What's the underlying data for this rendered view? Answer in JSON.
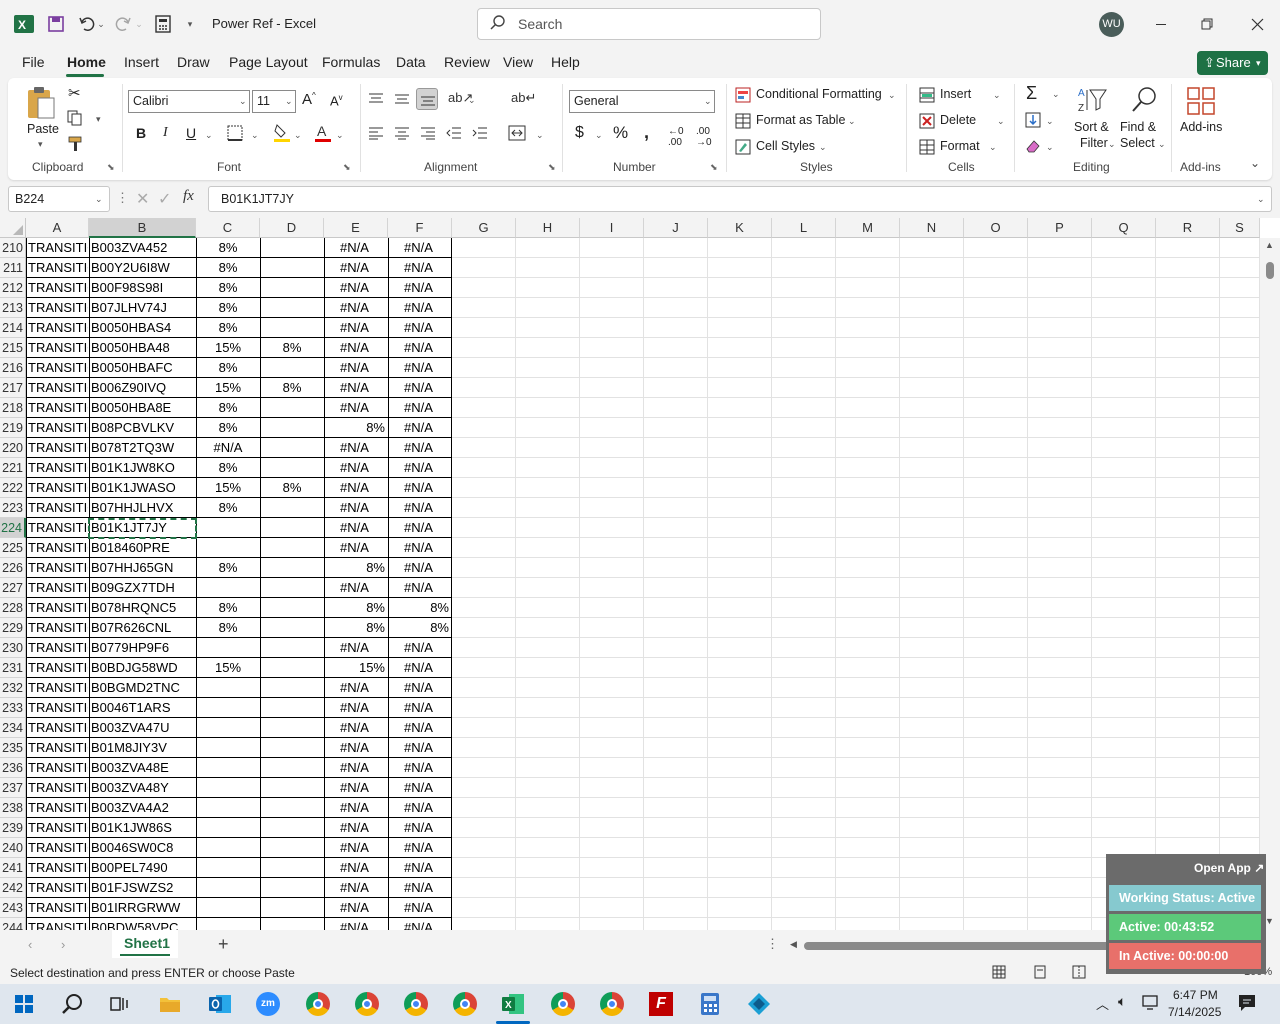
{
  "titlebar": {
    "app_title": "Power Ref  -  Excel",
    "search_placeholder": "Search",
    "user_initials": "WU"
  },
  "menu": {
    "items": [
      "File",
      "Home",
      "Insert",
      "Draw",
      "Page Layout",
      "Formulas",
      "Data",
      "Review",
      "View",
      "Help"
    ],
    "active": "Home",
    "share_label": "Share"
  },
  "ribbon": {
    "clipboard": {
      "paste": "Paste",
      "label": "Clipboard"
    },
    "font": {
      "name": "Calibri",
      "size": "11",
      "label": "Font"
    },
    "alignment": {
      "label": "Alignment"
    },
    "number": {
      "format": "General",
      "label": "Number"
    },
    "styles": {
      "conditional": "Conditional Formatting",
      "table": "Format as Table",
      "cell": "Cell Styles",
      "label": "Styles"
    },
    "cells": {
      "insert": "Insert",
      "delete": "Delete",
      "format": "Format",
      "label": "Cells"
    },
    "editing": {
      "sort": "Sort &",
      "filter": "Filter",
      "find": "Find &",
      "select": "Select",
      "label": "Editing"
    },
    "addins": {
      "name": "Add-ins",
      "label": "Add-ins"
    }
  },
  "formula": {
    "name_box": "B224",
    "value": "B01K1JT7JY"
  },
  "columns": [
    "A",
    "B",
    "C",
    "D",
    "E",
    "F",
    "G",
    "H",
    "I",
    "J",
    "K",
    "L",
    "M",
    "N",
    "O",
    "P",
    "Q",
    "R",
    "S"
  ],
  "rows": [
    {
      "n": "210",
      "a": "TRANSITIO",
      "b": "B003ZVA452",
      "c": "8%",
      "d": "",
      "e": "#N/A",
      "f": "#N/A"
    },
    {
      "n": "211",
      "a": "TRANSITIO",
      "b": "B00Y2U6I8W",
      "c": "8%",
      "d": "",
      "e": "#N/A",
      "f": "#N/A"
    },
    {
      "n": "212",
      "a": "TRANSITIO",
      "b": "B00F98S98I",
      "c": "8%",
      "d": "",
      "e": "#N/A",
      "f": "#N/A"
    },
    {
      "n": "213",
      "a": "TRANSITIO",
      "b": "B07JLHV74J",
      "c": "8%",
      "d": "",
      "e": "#N/A",
      "f": "#N/A"
    },
    {
      "n": "214",
      "a": "TRANSITIO",
      "b": "B0050HBAS4",
      "c": "8%",
      "d": "",
      "e": "#N/A",
      "f": "#N/A"
    },
    {
      "n": "215",
      "a": "TRANSITIO",
      "b": "B0050HBA48",
      "c": "15%",
      "d": "8%",
      "e": "#N/A",
      "f": "#N/A"
    },
    {
      "n": "216",
      "a": "TRANSITIO",
      "b": "B0050HBAFC",
      "c": "8%",
      "d": "",
      "e": "#N/A",
      "f": "#N/A"
    },
    {
      "n": "217",
      "a": "TRANSITIO",
      "b": "B006Z90IVQ",
      "c": "15%",
      "d": "8%",
      "e": "#N/A",
      "f": "#N/A"
    },
    {
      "n": "218",
      "a": "TRANSITIO",
      "b": "B0050HBA8E",
      "c": "8%",
      "d": "",
      "e": "#N/A",
      "f": "#N/A"
    },
    {
      "n": "219",
      "a": "TRANSITIO",
      "b": "B08PCBVLKV",
      "c": "8%",
      "d": "",
      "e": "8%",
      "f": "#N/A"
    },
    {
      "n": "220",
      "a": "TRANSITIO",
      "b": "B078T2TQ3W",
      "c": "#N/A",
      "d": "",
      "e": "#N/A",
      "f": "#N/A"
    },
    {
      "n": "221",
      "a": "TRANSITIO",
      "b": "B01K1JW8KO",
      "c": "8%",
      "d": "",
      "e": "#N/A",
      "f": "#N/A"
    },
    {
      "n": "222",
      "a": "TRANSITIO",
      "b": "B01K1JWASO",
      "c": "15%",
      "d": "8%",
      "e": "#N/A",
      "f": "#N/A"
    },
    {
      "n": "223",
      "a": "TRANSITIO",
      "b": "B07HHJLHVX",
      "c": "8%",
      "d": "",
      "e": "#N/A",
      "f": "#N/A"
    },
    {
      "n": "224",
      "a": "TRANSITIO",
      "b": "B01K1JT7JY",
      "c": "",
      "d": "",
      "e": "#N/A",
      "f": "#N/A"
    },
    {
      "n": "225",
      "a": "TRANSITIO",
      "b": "B018460PRE",
      "c": "",
      "d": "",
      "e": "#N/A",
      "f": "#N/A"
    },
    {
      "n": "226",
      "a": "TRANSITIO",
      "b": "B07HHJ65GN",
      "c": "8%",
      "d": "",
      "e": "8%",
      "f": "#N/A"
    },
    {
      "n": "227",
      "a": "TRANSITIO",
      "b": "B09GZX7TDH",
      "c": "",
      "d": "",
      "e": "#N/A",
      "f": "#N/A"
    },
    {
      "n": "228",
      "a": "TRANSITIO",
      "b": "B078HRQNC5",
      "c": "8%",
      "d": "",
      "e": "8%",
      "f": "8%"
    },
    {
      "n": "229",
      "a": "TRANSITIO",
      "b": "B07R626CNL",
      "c": "8%",
      "d": "",
      "e": "8%",
      "f": "8%"
    },
    {
      "n": "230",
      "a": "TRANSITIO",
      "b": "B0779HP9F6",
      "c": "",
      "d": "",
      "e": "#N/A",
      "f": "#N/A"
    },
    {
      "n": "231",
      "a": "TRANSITIO",
      "b": "B0BDJG58WD",
      "c": "15%",
      "d": "",
      "e": "15%",
      "f": "#N/A"
    },
    {
      "n": "232",
      "a": "TRANSITIO",
      "b": "B0BGMD2TNC",
      "c": "",
      "d": "",
      "e": "#N/A",
      "f": "#N/A"
    },
    {
      "n": "233",
      "a": "TRANSITIO",
      "b": "B0046T1ARS",
      "c": "",
      "d": "",
      "e": "#N/A",
      "f": "#N/A"
    },
    {
      "n": "234",
      "a": "TRANSITIO",
      "b": "B003ZVA47U",
      "c": "",
      "d": "",
      "e": "#N/A",
      "f": "#N/A"
    },
    {
      "n": "235",
      "a": "TRANSITIO",
      "b": "B01M8JIY3V",
      "c": "",
      "d": "",
      "e": "#N/A",
      "f": "#N/A"
    },
    {
      "n": "236",
      "a": "TRANSITIO",
      "b": "B003ZVA48E",
      "c": "",
      "d": "",
      "e": "#N/A",
      "f": "#N/A"
    },
    {
      "n": "237",
      "a": "TRANSITIO",
      "b": "B003ZVA48Y",
      "c": "",
      "d": "",
      "e": "#N/A",
      "f": "#N/A"
    },
    {
      "n": "238",
      "a": "TRANSITIO",
      "b": "B003ZVA4A2",
      "c": "",
      "d": "",
      "e": "#N/A",
      "f": "#N/A"
    },
    {
      "n": "239",
      "a": "TRANSITIO",
      "b": "B01K1JW86S",
      "c": "",
      "d": "",
      "e": "#N/A",
      "f": "#N/A"
    },
    {
      "n": "240",
      "a": "TRANSITIO",
      "b": "B0046SW0C8",
      "c": "",
      "d": "",
      "e": "#N/A",
      "f": "#N/A"
    },
    {
      "n": "241",
      "a": "TRANSITIO",
      "b": "B00PEL7490",
      "c": "",
      "d": "",
      "e": "#N/A",
      "f": "#N/A"
    },
    {
      "n": "242",
      "a": "TRANSITIO",
      "b": "B01FJSWZS2",
      "c": "",
      "d": "",
      "e": "#N/A",
      "f": "#N/A"
    },
    {
      "n": "243",
      "a": "TRANSITIO",
      "b": "B01IRRGRWW",
      "c": "",
      "d": "",
      "e": "#N/A",
      "f": "#N/A"
    },
    {
      "n": "244",
      "a": "TRANSITIO",
      "b": "B0BDW58VPC",
      "c": "",
      "d": "",
      "e": "#N/A",
      "f": "#N/A"
    }
  ],
  "sheet": {
    "tab": "Sheet1"
  },
  "status": {
    "message": "Select destination and press ENTER or choose Paste",
    "zoom": "100%"
  },
  "widget": {
    "open_app": "Open App ↗",
    "working": "Working Status: Active",
    "active": "Active: 00:43:52",
    "inactive": "In Active: 00:00:00"
  },
  "clock": {
    "time": "6:47 PM",
    "date": "7/14/2025"
  },
  "colors": {
    "excel_green": "#217346",
    "share_green": "#1e7145",
    "working_bg": "#86c9cf",
    "active_bg": "#5cc97a",
    "inactive_bg": "#e8706a"
  }
}
